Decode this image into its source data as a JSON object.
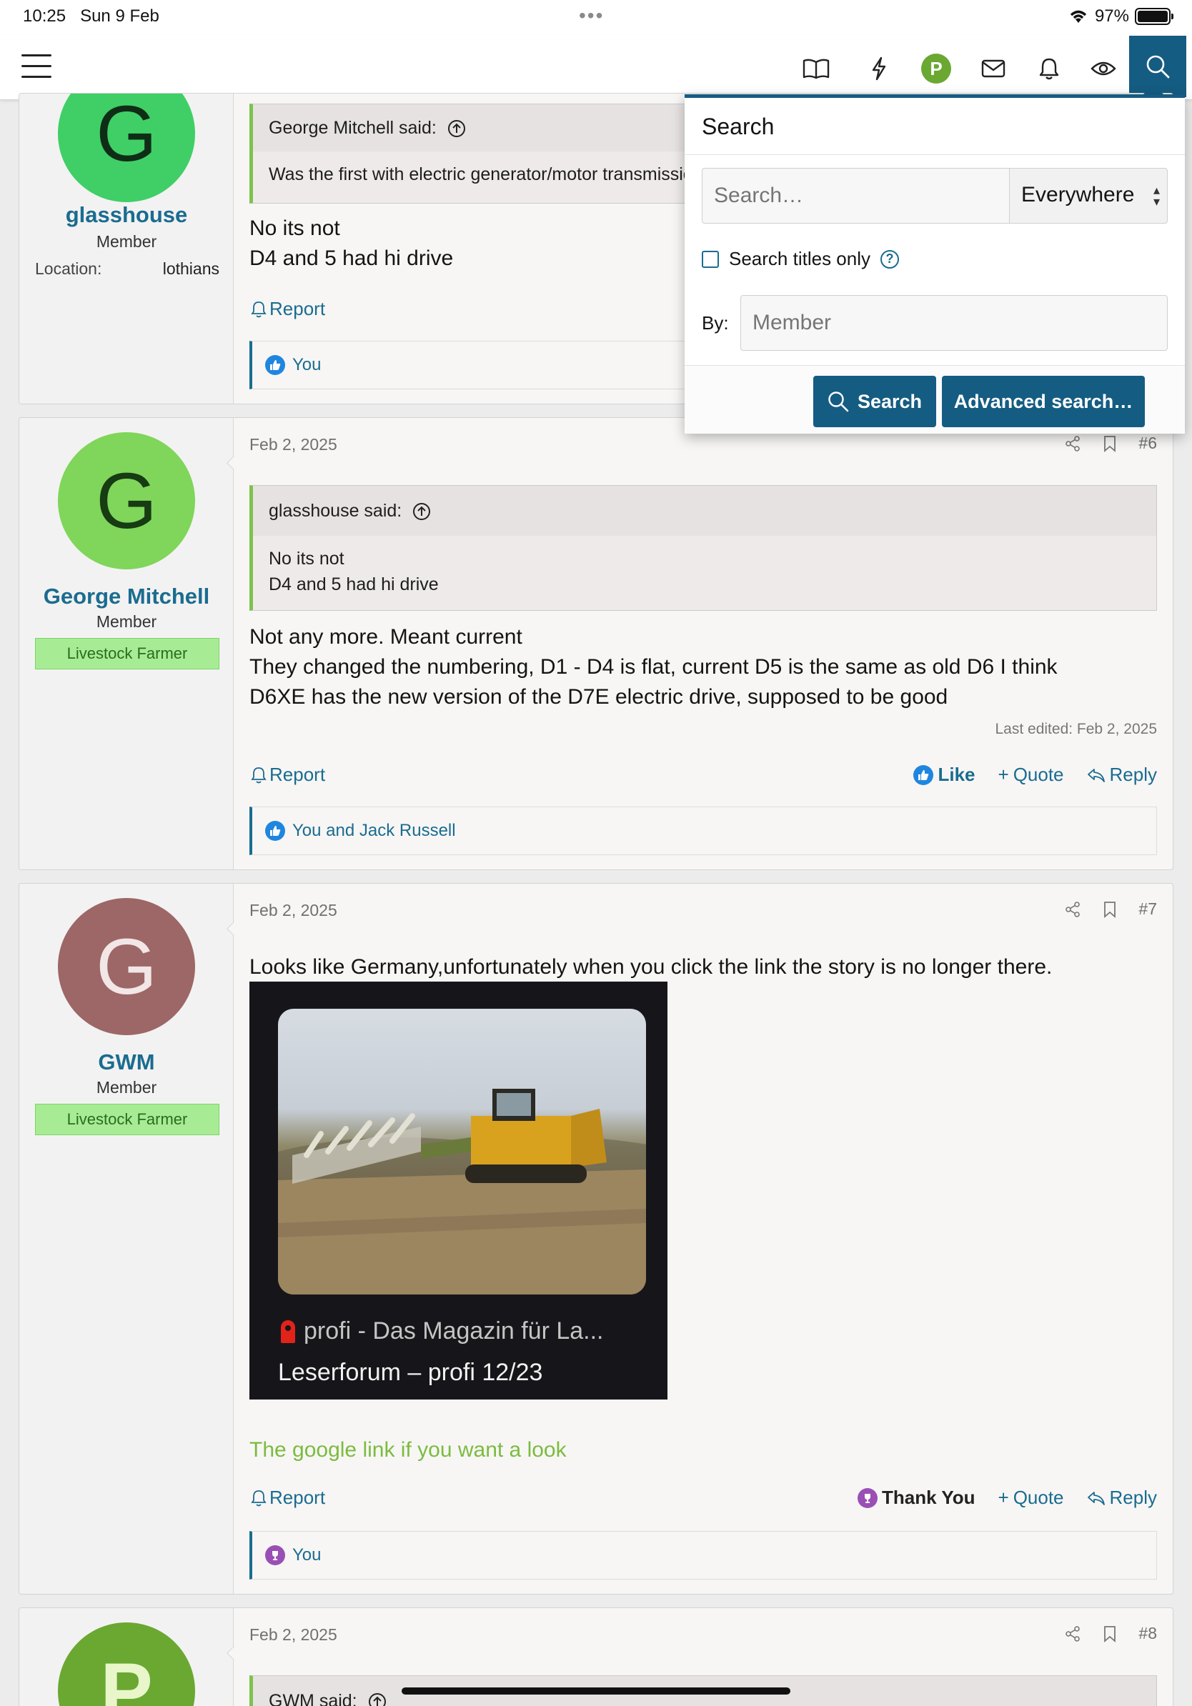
{
  "status": {
    "time": "10:25",
    "date": "Sun 9 Feb",
    "battery": "97%"
  },
  "header": {
    "icons": [
      "book-icon",
      "bolt-icon",
      "avatar",
      "mail-icon",
      "bell-icon",
      "eye-icon",
      "search-icon"
    ],
    "avatar_letter": "P"
  },
  "post5": {
    "avatar_letter": "G",
    "avatar_color": "#3fcf66",
    "username": "glasshouse",
    "usertitle": "Member",
    "location_label": "Location:",
    "location_value": "lothians",
    "quote_author": "George Mitchell said:",
    "quote_text": "Was the first with electric generator/motor transmission",
    "body_line1": "No its not",
    "body_line2": "D4 and 5 had hi drive",
    "report": "Report",
    "reactions": "You"
  },
  "post6": {
    "avatar_letter": "G",
    "avatar_color": "#7fd65a",
    "username": "George Mitchell",
    "usertitle": "Member",
    "banner": "Livestock Farmer",
    "date": "Feb 2, 2025",
    "number": "#6",
    "quote_author": "glasshouse said:",
    "quote_line1": "No its not",
    "quote_line2": "D4 and 5 had hi drive",
    "body_line1": "Not any more. Meant current",
    "body_line2": "They changed the numbering, D1 - D4 is flat, current D5 is the same as old D6 I think",
    "body_line3": "D6XE has the new version of the D7E electric drive, supposed to be good",
    "last_edited": "Last edited: Feb 2, 2025",
    "report": "Report",
    "like": "Like",
    "quote": "Quote",
    "reply": "Reply",
    "reactions": "You and Jack Russell"
  },
  "post7": {
    "avatar_letter": "G",
    "avatar_color": "#9c6766",
    "username": "GWM",
    "usertitle": "Member",
    "banner": "Livestock Farmer",
    "date": "Feb 2, 2025",
    "number": "#7",
    "body": "Looks like Germany,unfortunately when you click the link the story is no longer there.",
    "embed_source": "profi - Das Magazin für La...",
    "embed_title": "Leserforum – profi 12/23",
    "link_text": "The google link if you want a look",
    "report": "Report",
    "thank_you": "Thank You",
    "quote": "Quote",
    "reply": "Reply",
    "reactions": "You"
  },
  "post8": {
    "avatar_letter": "P",
    "avatar_color": "#6aa832",
    "date": "Feb 2, 2025",
    "number": "#8",
    "quote_author": "GWM said:"
  },
  "search_menu": {
    "title": "Search",
    "placeholder": "Search…",
    "scope": "Everywhere",
    "titles_only": "Search titles only",
    "by_label": "By:",
    "member_placeholder": "Member",
    "search_button": "Search",
    "advanced_button": "Advanced search…"
  },
  "colors": {
    "accent": "#155c82",
    "link": "#1a6c90",
    "banner": "#a7ec95",
    "quote_bar": "#7cc34c"
  }
}
